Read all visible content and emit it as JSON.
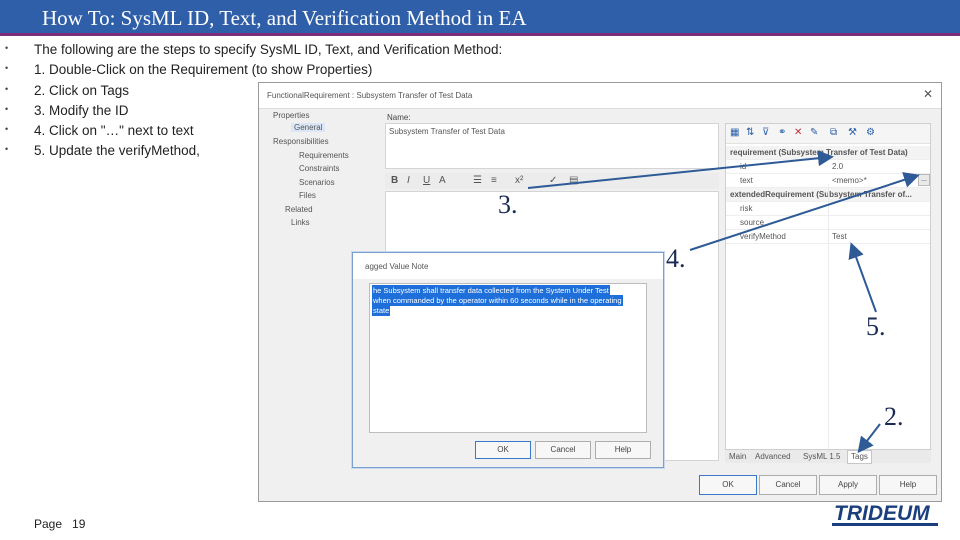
{
  "slide": {
    "title": "How To: SysML ID, Text, and Verification Method in EA",
    "bullets": [
      "The following are the steps to specify SysML ID, Text, and Verification Method:",
      "1. Double-Click on the Requirement (to show Properties)",
      "2. Click on Tags",
      "3. Modify the ID",
      "4. Click on \"…\" next to text",
      "5. Update the verifyMethod,"
    ],
    "page_label": "Page",
    "page_number": "19",
    "logo": "TRIDEUM"
  },
  "properties_window": {
    "title": "FunctionalRequirement : Subsystem Transfer of Test Data",
    "close": "✕",
    "tree": [
      "Properties",
      "General",
      "Responsibilities",
      "Requirements",
      "Constraints",
      "Scenarios",
      "Files",
      "Related",
      "Links"
    ],
    "name_label": "Name:",
    "name_value": "Subsystem Transfer of Test Data",
    "toolbar": [
      "B",
      "I",
      "U",
      "A"
    ],
    "tags": {
      "group1": "requirement (Subsystem Transfer of Test Data)",
      "id_key": "id",
      "id_value": "2.0",
      "text_key": "text",
      "text_value": "<memo>*",
      "ellipsis": "...",
      "group2": "extendedRequirement (Subsystem Transfer of...",
      "risk_key": "risk",
      "source_key": "source",
      "verify_key": "verifyMethod",
      "verify_value": "Test"
    },
    "tabs": [
      "Main",
      "Advanced",
      "SysML 1.5",
      "Tags"
    ],
    "buttons": [
      "OK",
      "Cancel",
      "Apply",
      "Help"
    ]
  },
  "tagged_value_dialog": {
    "title": "agged Value Note",
    "lines": [
      "he Subsystem shall transfer data collected from the System Under Test",
      "when commanded by the operator within 60 seconds while in the operating",
      "state"
    ],
    "buttons": [
      "OK",
      "Cancel",
      "Help"
    ]
  },
  "callouts": {
    "step2": "2.",
    "step3": "3.",
    "step4": "4.",
    "step5": "5."
  },
  "colors": {
    "title_bar": "#2f5fa8",
    "accent_line": "#7d2e7a",
    "selection": "#1e6fd9",
    "arrow": "#2e5a96",
    "logo": "#1b3f7d"
  }
}
